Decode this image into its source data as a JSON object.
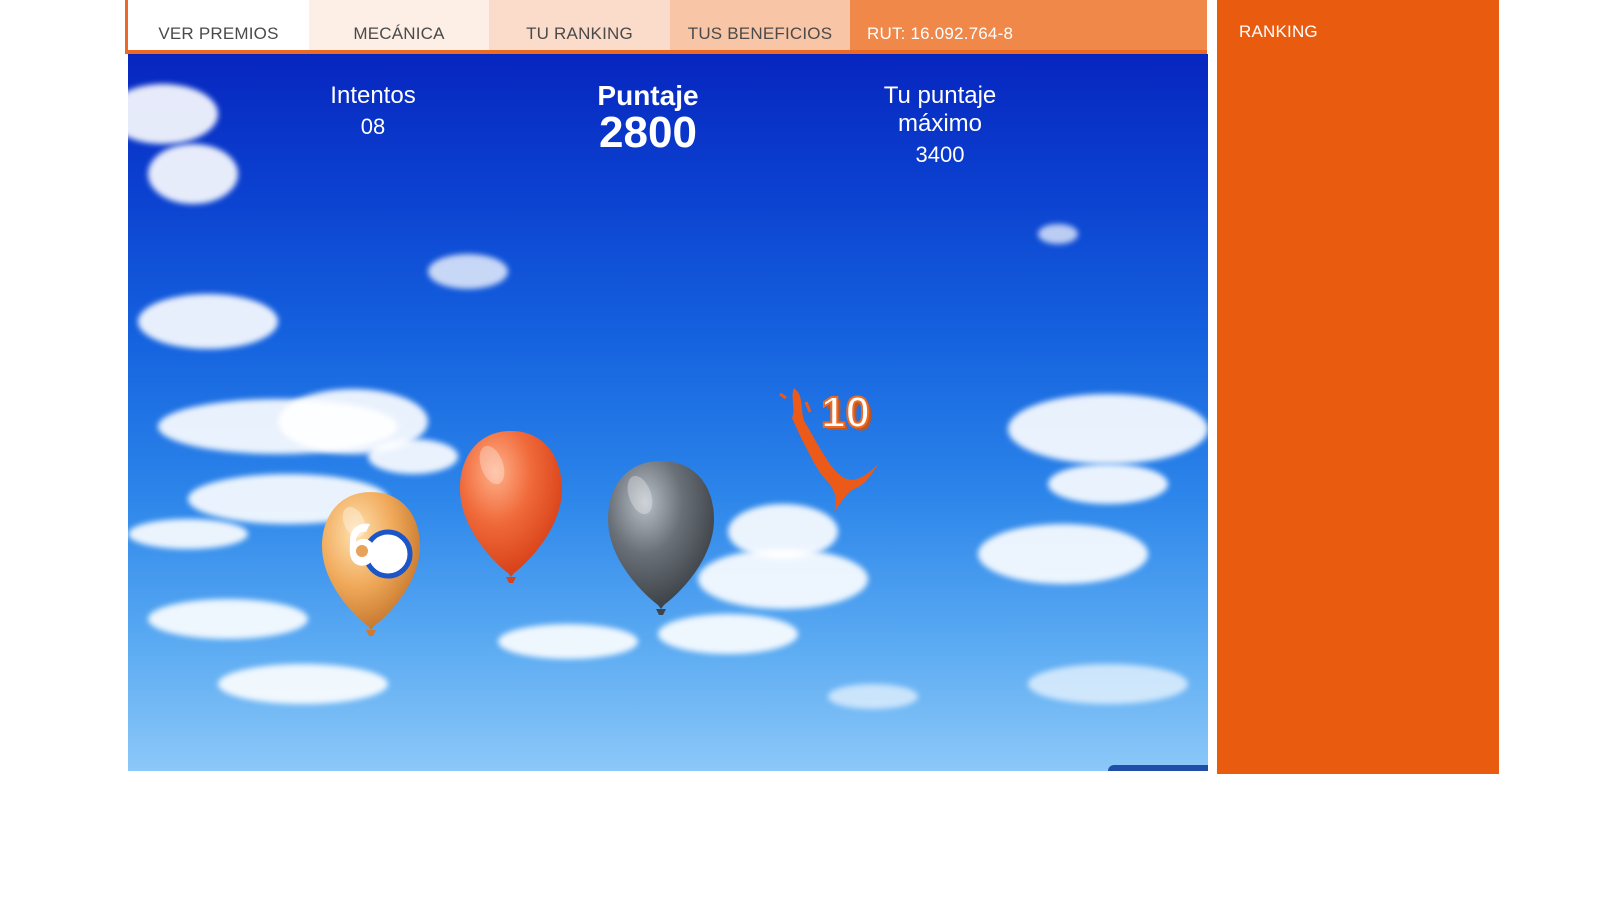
{
  "tabs": [
    {
      "label": "VER PREMIOS"
    },
    {
      "label": "MECÁNICA"
    },
    {
      "label": "TU RANKING"
    },
    {
      "label": "TUS BENEFICIOS"
    }
  ],
  "user": {
    "rut": "RUT: 16.092.764-8"
  },
  "hud": {
    "intentos_label": "Intentos",
    "intentos_value": "08",
    "puntaje_label": "Puntaje",
    "puntaje_value": "2800",
    "max_label": "Tu puntaje máximo",
    "max_value": "3400"
  },
  "game": {
    "balloons": [
      {
        "color": "gold",
        "badge": "60"
      },
      {
        "color": "orange"
      },
      {
        "color": "gray"
      }
    ],
    "popped_points": "10"
  },
  "sidebar": {
    "title": "RANKING"
  },
  "colors": {
    "accent": "#e95c10",
    "tab_bar": "#f0884a",
    "sky_top": "#0726bf",
    "sky_bottom": "#8cc8f8"
  }
}
